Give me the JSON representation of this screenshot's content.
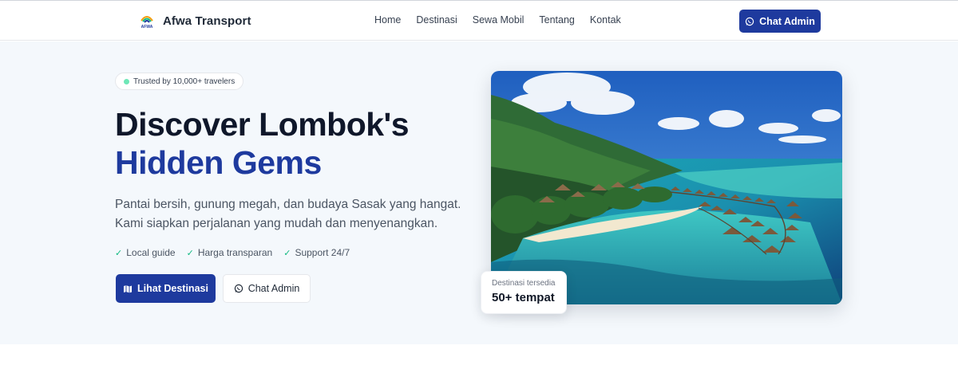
{
  "navbar": {
    "brand_name": "Afwa Transport",
    "logo_text": "AFWA",
    "links": [
      {
        "label": "Home"
      },
      {
        "label": "Destinasi"
      },
      {
        "label": "Sewa Mobil"
      },
      {
        "label": "Tentang"
      },
      {
        "label": "Kontak"
      }
    ],
    "cta_label": "Chat Admin"
  },
  "hero": {
    "badge": "Trusted by 10,000+ travelers",
    "title_line1": "Discover Lombok's",
    "title_line2": "Hidden Gems",
    "description": "Pantai bersih, gunung megah, dan budaya Sasak yang hangat. Kami siapkan perjalanan yang mudah dan menyenangkan.",
    "features": [
      "Local guide",
      "Harga transparan",
      "Support 24/7"
    ],
    "primary_button": "Lihat Destinasi",
    "secondary_button": "Chat Admin",
    "stat": {
      "label": "Destinasi tersedia",
      "value": "50+ tempat"
    }
  },
  "colors": {
    "primary": "#1e3a9e",
    "hero_bg": "#f4f8fc",
    "check": "#10b981",
    "badge_dot": "#6ee7b7"
  },
  "icons": [
    "whatsapp-icon",
    "map-icon",
    "check-icon",
    "logo-icon"
  ]
}
